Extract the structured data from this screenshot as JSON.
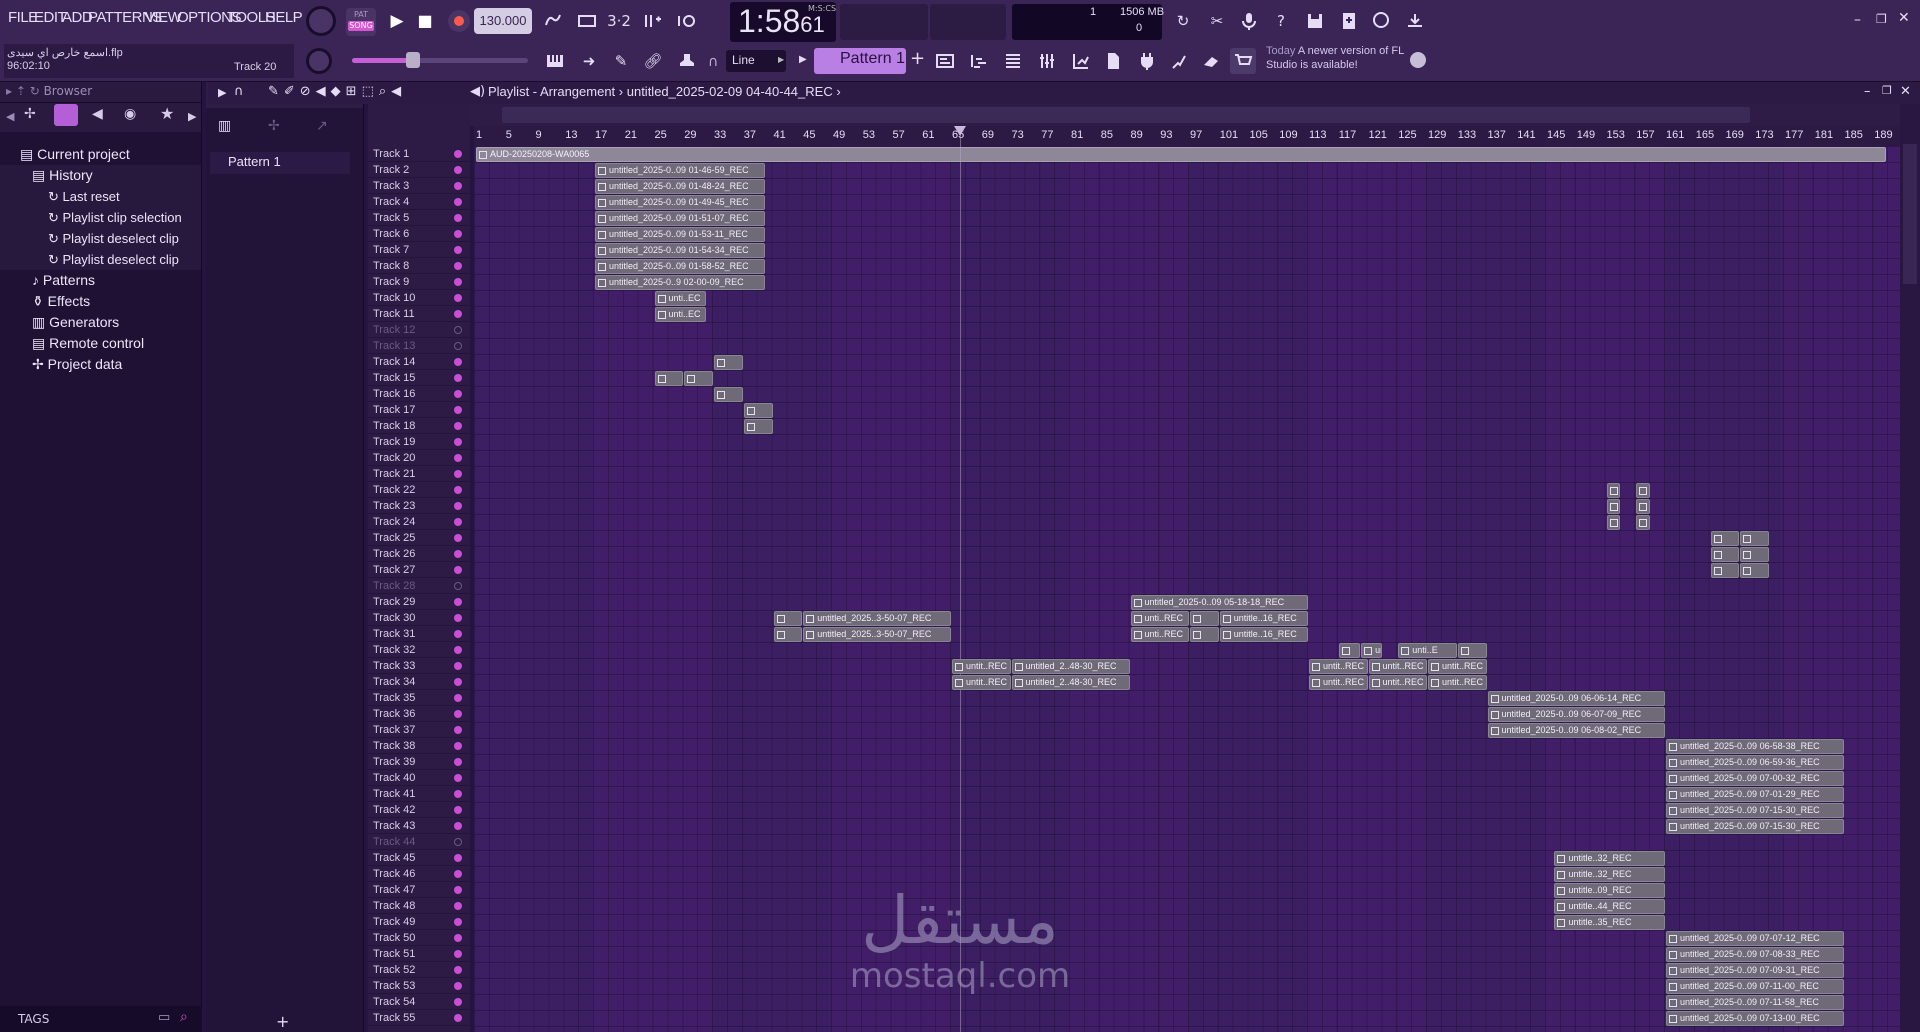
{
  "menu": [
    "FILE",
    "EDIT",
    "ADD",
    "PATTERNS",
    "VIEW",
    "OPTIONS",
    "TOOLS",
    "HELP"
  ],
  "transport": {
    "pat": "PAT",
    "song": "SONG",
    "tempo": "130.000",
    "time_main": "1:58",
    "time_sub": "61",
    "time_unit": "M:S:CS",
    "cpu_top": "1",
    "cpu_mem": "1506 MB",
    "cpu_bottom": "0"
  },
  "project": {
    "filename": "اسمع خارص اي سيدى.flp",
    "duration": "96:02:10",
    "track": "Track 20"
  },
  "snap": "Line",
  "pattern_selector": "Pattern 1",
  "news": {
    "when": "Today",
    "text": "A newer version of FL Studio is available!"
  },
  "browser": {
    "title": "Browser",
    "items": [
      {
        "label": "Current project",
        "level": 0
      },
      {
        "label": "History",
        "level": 1
      },
      {
        "label": "Last reset",
        "level": 2
      },
      {
        "label": "Playlist clip selection",
        "level": 2
      },
      {
        "label": "Playlist deselect clip",
        "level": 2
      },
      {
        "label": "Playlist deselect clip",
        "level": 2
      },
      {
        "label": "Patterns",
        "level": 1
      },
      {
        "label": "Effects",
        "level": 1
      },
      {
        "label": "Generators",
        "level": 1
      },
      {
        "label": "Remote control",
        "level": 1
      },
      {
        "label": "Project data",
        "level": 1
      }
    ],
    "tags": "TAGS"
  },
  "patterns": [
    "Pattern 1"
  ],
  "playlist": {
    "title": "Playlist - Arrangement",
    "breadcrumb": "untitled_2025-02-09 04-40-44_REC",
    "ruler": [
      "1",
      "5",
      "9",
      "13",
      "17",
      "21",
      "25",
      "29",
      "33",
      "37",
      "41",
      "45",
      "49",
      "53",
      "57",
      "61",
      "65",
      "69",
      "73",
      "77",
      "81",
      "85",
      "89",
      "93",
      "97",
      "101",
      "105",
      "109",
      "113",
      "117",
      "121",
      "125",
      "129",
      "133",
      "137",
      "141",
      "145",
      "149",
      "153",
      "157",
      "161",
      "165",
      "169",
      "173",
      "177",
      "181",
      "185",
      "189"
    ],
    "tracks": [
      "Track 1",
      "Track 2",
      "Track 3",
      "Track 4",
      "Track 5",
      "Track 6",
      "Track 7",
      "Track 8",
      "Track 9",
      "Track 10",
      "Track 11",
      "Track 12",
      "Track 13",
      "Track 14",
      "Track 15",
      "Track 16",
      "Track 17",
      "Track 18",
      "Track 19",
      "Track 20",
      "Track 21",
      "Track 22",
      "Track 23",
      "Track 24",
      "Track 25",
      "Track 26",
      "Track 27",
      "Track 28",
      "Track 29",
      "Track 30",
      "Track 31",
      "Track 32",
      "Track 33",
      "Track 34",
      "Track 35",
      "Track 36",
      "Track 37",
      "Track 38",
      "Track 39",
      "Track 40",
      "Track 41",
      "Track 42",
      "Track 43",
      "Track 44",
      "Track 45",
      "Track 46",
      "Track 47",
      "Track 48",
      "Track 49",
      "Track 50",
      "Track 51",
      "Track 52",
      "Track 53",
      "Track 54",
      "Track 55"
    ],
    "muted_tracks": [
      "Track 12",
      "Track 13",
      "Track 28",
      "Track 44"
    ],
    "audio_clip": "AUD-20250208-WA0065",
    "clips": [
      {
        "track": 2,
        "start": 17,
        "len": 23,
        "label": "untitled_2025-0..09 01-46-59_REC"
      },
      {
        "track": 3,
        "start": 17,
        "len": 23,
        "label": "untitled_2025-0..09 01-48-24_REC"
      },
      {
        "track": 4,
        "start": 17,
        "len": 23,
        "label": "untitled_2025-0..09 01-49-45_REC"
      },
      {
        "track": 5,
        "start": 17,
        "len": 23,
        "label": "untitled_2025-0..09 01-51-07_REC"
      },
      {
        "track": 6,
        "start": 17,
        "len": 23,
        "label": "untitled_2025-0..09 01-53-11_REC"
      },
      {
        "track": 7,
        "start": 17,
        "len": 23,
        "label": "untitled_2025-0..09 01-54-34_REC"
      },
      {
        "track": 8,
        "start": 17,
        "len": 23,
        "label": "untitled_2025-0..09 01-58-52_REC"
      },
      {
        "track": 9,
        "start": 17,
        "len": 23,
        "label": "untitled_2025-0..9 02-00-09_REC"
      },
      {
        "track": 10,
        "start": 25,
        "len": 7,
        "label": "unti..EC"
      },
      {
        "track": 11,
        "start": 25,
        "len": 7,
        "label": "unti..EC"
      },
      {
        "track": 14,
        "start": 33,
        "len": 4,
        "label": ""
      },
      {
        "track": 15,
        "start": 25,
        "len": 4,
        "label": ""
      },
      {
        "track": 15,
        "start": 29,
        "len": 4,
        "label": ""
      },
      {
        "track": 16,
        "start": 33,
        "len": 4,
        "label": ""
      },
      {
        "track": 17,
        "start": 37,
        "len": 4,
        "label": ""
      },
      {
        "track": 18,
        "start": 37,
        "len": 4,
        "label": ""
      },
      {
        "track": 22,
        "start": 153,
        "len": 2,
        "label": ""
      },
      {
        "track": 22,
        "start": 157,
        "len": 2,
        "label": ""
      },
      {
        "track": 23,
        "start": 153,
        "len": 2,
        "label": ""
      },
      {
        "track": 23,
        "start": 157,
        "len": 2,
        "label": ""
      },
      {
        "track": 24,
        "start": 153,
        "len": 2,
        "label": ""
      },
      {
        "track": 24,
        "start": 157,
        "len": 2,
        "label": ""
      },
      {
        "track": 25,
        "start": 167,
        "len": 4,
        "label": ""
      },
      {
        "track": 25,
        "start": 171,
        "len": 4,
        "label": ""
      },
      {
        "track": 26,
        "start": 167,
        "len": 4,
        "label": ""
      },
      {
        "track": 26,
        "start": 171,
        "len": 4,
        "label": ""
      },
      {
        "track": 27,
        "start": 167,
        "len": 4,
        "label": ""
      },
      {
        "track": 27,
        "start": 171,
        "len": 4,
        "label": ""
      },
      {
        "track": 29,
        "start": 89,
        "len": 24,
        "label": "untitled_2025-0..09 05-18-18_REC"
      },
      {
        "track": 30,
        "start": 41,
        "len": 4,
        "label": ""
      },
      {
        "track": 30,
        "start": 45,
        "len": 20,
        "label": "untitled_2025..3-50-07_REC"
      },
      {
        "track": 30,
        "start": 89,
        "len": 8,
        "label": "unti..REC"
      },
      {
        "track": 30,
        "start": 97,
        "len": 4,
        "label": ""
      },
      {
        "track": 30,
        "start": 101,
        "len": 12,
        "label": "untitle..16_REC"
      },
      {
        "track": 31,
        "start": 41,
        "len": 4,
        "label": ""
      },
      {
        "track": 31,
        "start": 45,
        "len": 20,
        "label": "untitled_2025..3-50-07_REC"
      },
      {
        "track": 31,
        "start": 89,
        "len": 8,
        "label": "unti..REC"
      },
      {
        "track": 31,
        "start": 97,
        "len": 4,
        "label": ""
      },
      {
        "track": 31,
        "start": 101,
        "len": 12,
        "label": "untitle..16_REC"
      },
      {
        "track": 32,
        "start": 117,
        "len": 3,
        "label": ""
      },
      {
        "track": 32,
        "start": 120,
        "len": 3,
        "label": "un..0"
      },
      {
        "track": 32,
        "start": 125,
        "len": 8,
        "label": "unti..E"
      },
      {
        "track": 32,
        "start": 133,
        "len": 4,
        "label": ""
      },
      {
        "track": 33,
        "start": 65,
        "len": 8,
        "label": "untit..REC"
      },
      {
        "track": 33,
        "start": 73,
        "len": 16,
        "label": "untitled_2..48-30_REC"
      },
      {
        "track": 33,
        "start": 113,
        "len": 8,
        "label": "untit..REC"
      },
      {
        "track": 33,
        "start": 121,
        "len": 8,
        "label": "untit..REC"
      },
      {
        "track": 33,
        "start": 129,
        "len": 8,
        "label": "untit..REC"
      },
      {
        "track": 34,
        "start": 65,
        "len": 8,
        "label": "untit..REC"
      },
      {
        "track": 34,
        "start": 73,
        "len": 16,
        "label": "untitled_2..48-30_REC"
      },
      {
        "track": 34,
        "start": 113,
        "len": 8,
        "label": "untit..REC"
      },
      {
        "track": 34,
        "start": 121,
        "len": 8,
        "label": "untit..REC"
      },
      {
        "track": 34,
        "start": 129,
        "len": 8,
        "label": "untit..REC"
      },
      {
        "track": 35,
        "start": 137,
        "len": 24,
        "label": "untitled_2025-0..09 06-06-14_REC"
      },
      {
        "track": 36,
        "start": 137,
        "len": 24,
        "label": "untitled_2025-0..09 06-07-09_REC"
      },
      {
        "track": 37,
        "start": 137,
        "len": 24,
        "label": "untitled_2025-0..09 06-08-02_REC"
      },
      {
        "track": 38,
        "start": 161,
        "len": 24,
        "label": "untitled_2025-0..09 06-58-38_REC"
      },
      {
        "track": 39,
        "start": 161,
        "len": 24,
        "label": "untitled_2025-0..09 06-59-36_REC"
      },
      {
        "track": 40,
        "start": 161,
        "len": 24,
        "label": "untitled_2025-0..09 07-00-32_REC"
      },
      {
        "track": 41,
        "start": 161,
        "len": 24,
        "label": "untitled_2025-0..09 07-01-29_REC"
      },
      {
        "track": 42,
        "start": 161,
        "len": 24,
        "label": "untitled_2025-0..09 07-15-30_REC"
      },
      {
        "track": 43,
        "start": 161,
        "len": 24,
        "label": "untitled_2025-0..09 07-15-30_REC"
      },
      {
        "track": 45,
        "start": 146,
        "len": 15,
        "label": "untitle..32_REC"
      },
      {
        "track": 46,
        "start": 146,
        "len": 15,
        "label": "untitle..32_REC"
      },
      {
        "track": 47,
        "start": 146,
        "len": 15,
        "label": "untitle..09_REC"
      },
      {
        "track": 48,
        "start": 146,
        "len": 15,
        "label": "untitle..44_REC"
      },
      {
        "track": 49,
        "start": 146,
        "len": 15,
        "label": "untitle..35_REC"
      },
      {
        "track": 50,
        "start": 161,
        "len": 24,
        "label": "untitled_2025-0..09 07-07-12_REC"
      },
      {
        "track": 51,
        "start": 161,
        "len": 24,
        "label": "untitled_2025-0..09 07-08-33_REC"
      },
      {
        "track": 52,
        "start": 161,
        "len": 24,
        "label": "untitled_2025-0..09 07-09-31_REC"
      },
      {
        "track": 53,
        "start": 161,
        "len": 24,
        "label": "untitled_2025-0..09 07-11-00_REC"
      },
      {
        "track": 54,
        "start": 161,
        "len": 24,
        "label": "untitled_2025-0..09 07-11-58_REC"
      },
      {
        "track": 55,
        "start": 161,
        "len": 24,
        "label": "untitled_2025-0..09 07-13-00_REC"
      }
    ]
  },
  "watermark": {
    "arabic": "مستقل",
    "latin": "mostaql.com"
  },
  "colors": {
    "accent": "#c94fd6",
    "grid": "#3c1f63",
    "clip": "#6f6a78",
    "song_mode": "#d456d0",
    "pattern": "#b97fe5"
  }
}
